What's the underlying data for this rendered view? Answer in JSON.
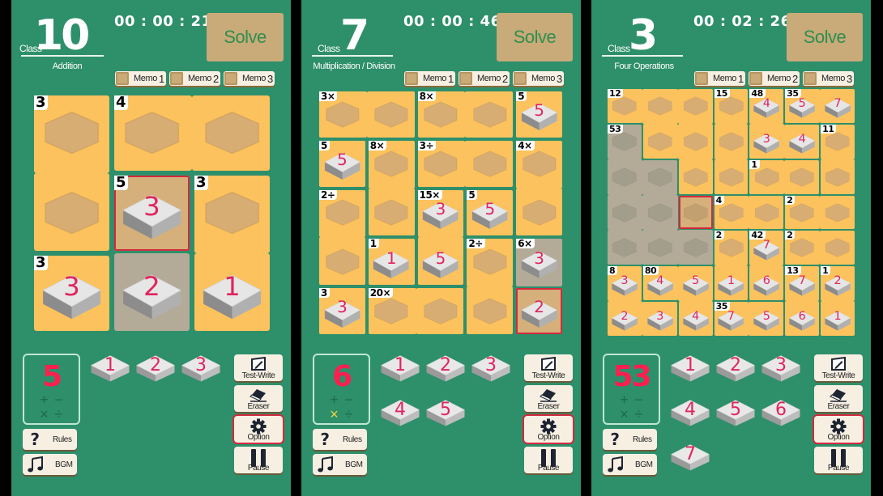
{
  "colors": {
    "background": "#2e8f6b",
    "cage": "#fcc25d",
    "cage_highlight": "#b3ab97",
    "selected": "#d5b07a",
    "accent_red": "#d4293d",
    "digit": "#e0245e",
    "solve_button": "#c9aa79",
    "active_op": "#f0d540"
  },
  "common": {
    "class_label": "Class",
    "solve_label": "Solve",
    "memos": [
      {
        "label": "Memo",
        "num": "1"
      },
      {
        "label": "Memo",
        "num": "2"
      },
      {
        "label": "Memo",
        "num": "3"
      }
    ],
    "rules_label": "Rules",
    "bgm_label": "BGM",
    "test_write_label": "Test-Write",
    "eraser_label": "Eraser",
    "option_label": "Option",
    "pause_label": "Pause",
    "ops": [
      "+",
      "−",
      "×",
      "÷"
    ]
  },
  "panels": [
    {
      "class_num": "10",
      "mode": "Addition",
      "timer": "00 : 00 : 21",
      "grid_size": 3,
      "cages": [
        {
          "label": "3",
          "cells": [
            [
              0,
              0
            ],
            [
              1,
              0
            ]
          ]
        },
        {
          "label": "4",
          "cells": [
            [
              0,
              1
            ],
            [
              0,
              2
            ]
          ]
        },
        {
          "label": "5",
          "cells": [
            [
              1,
              1
            ],
            [
              2,
              1
            ]
          ]
        },
        {
          "label": "3",
          "cells": [
            [
              1,
              2
            ],
            [
              2,
              2
            ]
          ]
        },
        {
          "label": "3",
          "cells": [
            [
              2,
              0
            ]
          ]
        }
      ],
      "values": [
        [
          null,
          null,
          null
        ],
        [
          null,
          "3",
          null
        ],
        [
          "3",
          "2",
          "1"
        ]
      ],
      "highlight": [
        [
          2,
          1
        ]
      ],
      "selected": [
        1,
        1
      ],
      "target": "5",
      "active_op": null,
      "keypad": [
        "1",
        "2",
        "3"
      ]
    },
    {
      "class_num": "7",
      "mode": "Multiplication / Division",
      "timer": "00 : 00 : 46",
      "grid_size": 5,
      "cages": [
        {
          "label": "3×",
          "cells": [
            [
              0,
              0
            ],
            [
              0,
              1
            ]
          ]
        },
        {
          "label": "8×",
          "cells": [
            [
              0,
              2
            ],
            [
              0,
              3
            ]
          ]
        },
        {
          "label": "5",
          "cells": [
            [
              0,
              4
            ]
          ]
        },
        {
          "label": "5",
          "cells": [
            [
              1,
              0
            ]
          ]
        },
        {
          "label": "8×",
          "cells": [
            [
              1,
              1
            ],
            [
              2,
              1
            ]
          ]
        },
        {
          "label": "3÷",
          "cells": [
            [
              1,
              2
            ],
            [
              1,
              3
            ]
          ]
        },
        {
          "label": "4×",
          "cells": [
            [
              1,
              4
            ],
            [
              2,
              4
            ]
          ]
        },
        {
          "label": "2÷",
          "cells": [
            [
              2,
              0
            ],
            [
              3,
              0
            ]
          ]
        },
        {
          "label": "15×",
          "cells": [
            [
              2,
              2
            ],
            [
              3,
              2
            ]
          ]
        },
        {
          "label": "5",
          "cells": [
            [
              2,
              3
            ]
          ]
        },
        {
          "label": "1",
          "cells": [
            [
              3,
              1
            ]
          ]
        },
        {
          "label": "2÷",
          "cells": [
            [
              3,
              3
            ],
            [
              4,
              3
            ]
          ]
        },
        {
          "label": "6×",
          "cells": [
            [
              3,
              4
            ],
            [
              4,
              4
            ]
          ]
        },
        {
          "label": "3",
          "cells": [
            [
              4,
              0
            ]
          ]
        },
        {
          "label": "20×",
          "cells": [
            [
              4,
              1
            ],
            [
              4,
              2
            ]
          ]
        }
      ],
      "values": [
        [
          null,
          null,
          null,
          null,
          "5"
        ],
        [
          "5",
          null,
          null,
          null,
          null
        ],
        [
          null,
          null,
          "3",
          "5",
          null
        ],
        [
          null,
          "1",
          "5",
          null,
          "3"
        ],
        [
          "3",
          null,
          null,
          null,
          "2"
        ]
      ],
      "highlight": [
        [
          3,
          4
        ]
      ],
      "selected": [
        4,
        4
      ],
      "target": "6",
      "active_op": "×",
      "keypad": [
        "1",
        "2",
        "3",
        "4",
        "5"
      ]
    },
    {
      "class_num": "3",
      "mode": "Four Operations",
      "timer": "00 : 02 : 26",
      "grid_size": 7,
      "cages": [
        {
          "label": "12",
          "cells": [
            [
              0,
              0
            ],
            [
              0,
              1
            ],
            [
              0,
              2
            ],
            [
              1,
              1
            ],
            [
              1,
              2
            ],
            [
              2,
              2
            ]
          ]
        },
        {
          "label": "15",
          "cells": [
            [
              0,
              3
            ],
            [
              1,
              3
            ],
            [
              2,
              3
            ]
          ]
        },
        {
          "label": "48",
          "cells": [
            [
              0,
              4
            ],
            [
              1,
              4
            ],
            [
              1,
              5
            ]
          ]
        },
        {
          "label": "35",
          "cells": [
            [
              0,
              5
            ],
            [
              0,
              6
            ]
          ]
        },
        {
          "label": "53",
          "cells": [
            [
              1,
              0
            ],
            [
              2,
              0
            ],
            [
              2,
              1
            ],
            [
              3,
              0
            ],
            [
              3,
              1
            ],
            [
              3,
              2
            ],
            [
              4,
              0
            ],
            [
              4,
              1
            ],
            [
              4,
              2
            ]
          ]
        },
        {
          "label": "11",
          "cells": [
            [
              1,
              6
            ],
            [
              2,
              6
            ]
          ]
        },
        {
          "label": "1",
          "cells": [
            [
              2,
              4
            ],
            [
              2,
              5
            ]
          ]
        },
        {
          "label": "4",
          "cells": [
            [
              3,
              3
            ],
            [
              3,
              4
            ]
          ]
        },
        {
          "label": "2",
          "cells": [
            [
              3,
              5
            ],
            [
              3,
              6
            ]
          ]
        },
        {
          "label": "2",
          "cells": [
            [
              4,
              3
            ],
            [
              5,
              3
            ]
          ]
        },
        {
          "label": "42",
          "cells": [
            [
              4,
              4
            ],
            [
              5,
              4
            ]
          ]
        },
        {
          "label": "2",
          "cells": [
            [
              4,
              5
            ],
            [
              4,
              6
            ]
          ]
        },
        {
          "label": "8",
          "cells": [
            [
              5,
              0
            ],
            [
              6,
              0
            ],
            [
              6,
              1
            ]
          ]
        },
        {
          "label": "80",
          "cells": [
            [
              5,
              1
            ],
            [
              5,
              2
            ],
            [
              6,
              2
            ]
          ]
        },
        {
          "label": "13",
          "cells": [
            [
              5,
              5
            ],
            [
              6,
              5
            ]
          ]
        },
        {
          "label": "1",
          "cells": [
            [
              5,
              6
            ],
            [
              6,
              6
            ]
          ]
        },
        {
          "label": "35",
          "cells": [
            [
              6,
              3
            ],
            [
              6,
              4
            ]
          ]
        }
      ],
      "values": [
        [
          null,
          null,
          null,
          null,
          "4",
          "5",
          "7"
        ],
        [
          null,
          null,
          null,
          null,
          "3",
          "4",
          null
        ],
        [
          null,
          null,
          null,
          null,
          null,
          null,
          null
        ],
        [
          null,
          null,
          null,
          null,
          null,
          null,
          null
        ],
        [
          null,
          null,
          null,
          null,
          "7",
          null,
          null
        ],
        [
          "3",
          "4",
          "5",
          "1",
          "6",
          "7",
          "2"
        ],
        [
          "2",
          "3",
          "4",
          "7",
          "5",
          "6",
          "1"
        ]
      ],
      "highlight": [
        [
          1,
          0
        ],
        [
          2,
          0
        ],
        [
          2,
          1
        ],
        [
          3,
          0
        ],
        [
          3,
          1
        ],
        [
          4,
          0
        ],
        [
          4,
          1
        ],
        [
          4,
          2
        ]
      ],
      "selected": [
        3,
        2
      ],
      "target": "53",
      "active_op": null,
      "keypad": [
        "1",
        "2",
        "3",
        "4",
        "5",
        "6",
        "7"
      ]
    }
  ]
}
